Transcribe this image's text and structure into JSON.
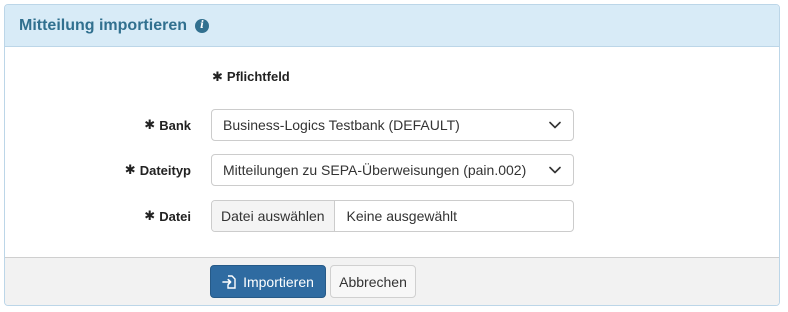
{
  "panel": {
    "title": "Mitteilung importieren",
    "info_icon": "info-icon"
  },
  "form": {
    "required_marker": "✱",
    "required_note": "Pflichtfeld",
    "bank": {
      "label": "Bank",
      "value": "Business-Logics Testbank (DEFAULT)"
    },
    "file_type": {
      "label": "Dateityp",
      "value": "Mitteilungen zu SEPA-Überweisungen (pain.002)"
    },
    "file": {
      "label": "Datei",
      "choose_label": "Datei auswählen",
      "status": "Keine ausgewählt"
    }
  },
  "footer": {
    "import_label": "Importieren",
    "import_icon": "file-import-icon",
    "cancel_label": "Abbrechen"
  },
  "colors": {
    "heading_bg": "#d8ebf7",
    "heading_text": "#31708f",
    "primary": "#2f6ba1"
  }
}
